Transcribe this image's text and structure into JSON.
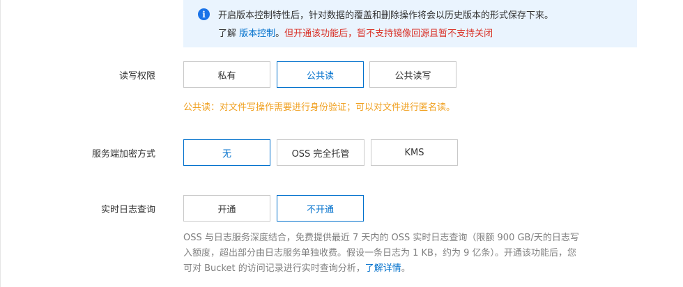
{
  "notice": {
    "line1": "开启版本控制特性后，针对数据的覆盖和删除操作将会以历史版本的形式保存下来。",
    "line2_prefix": "了解 ",
    "line2_link": "版本控制",
    "line2_sep": "。",
    "line2_warning": "但开通该功能后，暂不支持镜像回源且暂不支持关闭"
  },
  "acl": {
    "label": "读写权限",
    "options": [
      "私有",
      "公共读",
      "公共读写"
    ],
    "selected": "公共读",
    "hint": "公共读：对文件写操作需要进行身份验证；可以对文件进行匿名读。"
  },
  "encryption": {
    "label": "服务端加密方式",
    "options": [
      "无",
      "OSS 完全托管",
      "KMS"
    ],
    "selected": "无"
  },
  "realtime_log": {
    "label": "实时日志查询",
    "options": [
      "开通",
      "不开通"
    ],
    "selected": "不开通",
    "desc_line1": "OSS 与日志服务深度结合，免费提供最近 7 天内的 OSS 实时日志查询（限额 900 GB/天的日志写",
    "desc_line2": "入额度，超出部分由日志服务单独收费。假设一条日志为 1 KB，约为 9 亿条）。开通该功能后，您",
    "desc_line3_prefix": "可对 Bucket 的访问记录进行实时查询分析，",
    "desc_link": "了解详情",
    "desc_line3_suffix": "。"
  },
  "colors": {
    "accent": "#0070cc",
    "notice_bg": "#eaf4fe",
    "warning": "#d93026",
    "hint": "#f0a020"
  }
}
